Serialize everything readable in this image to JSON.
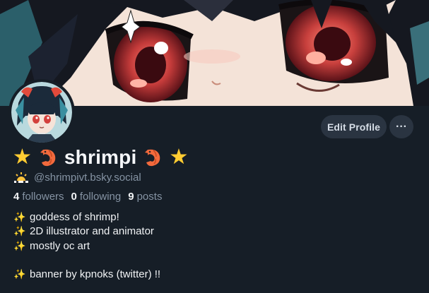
{
  "profile": {
    "display_name": "shrimpi",
    "handle": "@shrimpivt.bsky.social",
    "name_decor_left": "★",
    "name_decor_right": "★",
    "stats": {
      "followers_count": "4",
      "followers_label": "followers",
      "following_count": "0",
      "following_label": "following",
      "posts_count": "9",
      "posts_label": "posts"
    },
    "bio": [
      "goddess of shrimp!",
      "2D illustrator and animator",
      "mostly oc art",
      "banner by kpnoks (twitter) !!"
    ]
  },
  "actions": {
    "edit_profile_label": "Edit Profile",
    "more_label": "···"
  },
  "icons": {
    "handle_icon": "sunrise-icon",
    "bio_icon": "sparkles-icon",
    "name_icon": "shrimp-icon"
  },
  "colors": {
    "background": "#161e27",
    "button_bg": "#2a3441",
    "muted_text": "#8593a3",
    "star": "#ffcc33",
    "shrimp": "#f26a3d"
  }
}
